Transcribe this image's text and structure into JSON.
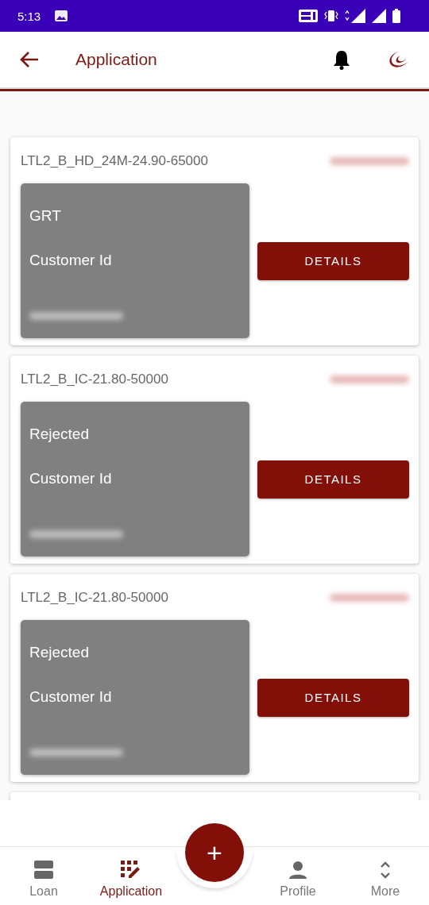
{
  "status_bar": {
    "time": "5:13"
  },
  "header": {
    "title": "Application"
  },
  "applications": [
    {
      "product": "LTL2_B_HD_24M-24.90-65000",
      "status": "GRT",
      "id_label": "Customer Id",
      "button": "DETAILS"
    },
    {
      "product": "LTL2_B_IC-21.80-50000",
      "status": "Rejected",
      "id_label": "Customer Id",
      "button": "DETAILS"
    },
    {
      "product": "LTL2_B_IC-21.80-50000",
      "status": "Rejected",
      "id_label": "Customer Id",
      "button": "DETAILS"
    }
  ],
  "bottom_nav": [
    {
      "label": "Loan",
      "kind": "loan",
      "selected": false
    },
    {
      "label": "Application",
      "kind": "application",
      "selected": true
    },
    {
      "label": "Profile",
      "kind": "profile",
      "selected": false
    },
    {
      "label": "More",
      "kind": "more",
      "selected": false
    }
  ],
  "fab": {
    "label": "+"
  }
}
